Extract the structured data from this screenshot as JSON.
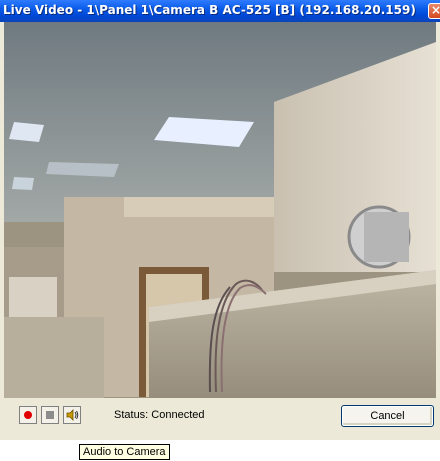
{
  "window": {
    "title": "Live Video -  1\\Panel 1\\Camera B AC-525 [B] (192.168.20.159)",
    "close_glyph": "×"
  },
  "video": {
    "content": "camera-feed",
    "stream_state": "live"
  },
  "controls": {
    "record_icon": "record-icon",
    "stop_icon": "stop-icon",
    "audio_icon": "speaker-icon",
    "status_text": "Status: Connected",
    "cancel_label": "Cancel"
  },
  "tooltip": {
    "text": "Audio to Camera"
  },
  "colors": {
    "titlebar": "#0a5ce8",
    "window_bg": "#ece9d8",
    "record": "#e00000",
    "tooltip_bg": "#ffffe1"
  }
}
